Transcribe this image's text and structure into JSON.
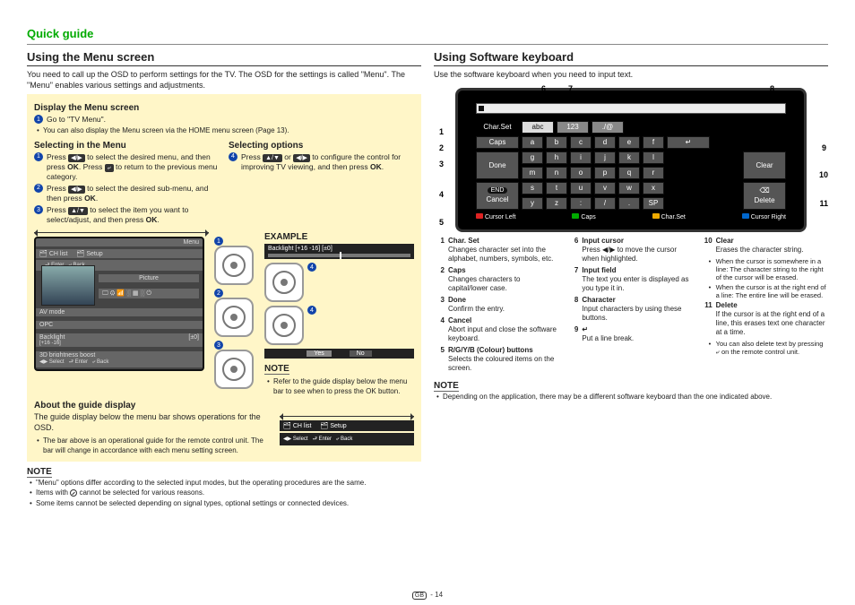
{
  "page_label": "14",
  "region_code": "GB",
  "quick_guide": "Quick guide",
  "left": {
    "heading": "Using the Menu screen",
    "intro": "You need to call up the OSD to perform settings for the TV. The OSD for the settings is called \"Menu\". The \"Menu\" enables various settings and adjustments.",
    "display_heading": "Display the Menu screen",
    "display_step1": "Go to \"TV Menu\".",
    "display_note": "You can also display the Menu screen via the HOME menu screen (Page 13).",
    "selecting_heading": "Selecting in the Menu",
    "sel_options_heading": "Selecting options",
    "example_label": "EXAMPLE",
    "sel_step1a": "Press ",
    "sel_step1b": " to select the desired menu, and then press ",
    "sel_step1c": ". Press ",
    "sel_step1d": " to return to the previous menu category.",
    "ok": "OK",
    "sel_step2a": "Press ",
    "sel_step2b": " to select the desired sub-menu, and then press ",
    "sel_step2c": ".",
    "sel_step3a": "Press ",
    "sel_step3b": " to select the item you want to select/adjust, and then press ",
    "sel_step3c": ".",
    "sel_opt4a": "Press ",
    "sel_opt4b": " or ",
    "sel_opt4c": " to configure the control for improving TV viewing, and then press ",
    "sel_opt4d": ".",
    "mid_note": "Refer to the guide display below the menu bar to see when to press the OK button.",
    "tv_labels": {
      "menu": "Menu",
      "chlist": "CH list",
      "setup": "Setup",
      "enter": "Enter",
      "back": "Back",
      "picture": "Picture",
      "avmode": "AV mode",
      "opc": "OPC",
      "backlight": "Backlight",
      "select": "Select",
      "threed": "3D brightness boost",
      "yes": "Yes",
      "no": "No"
    },
    "backlight_range": "[+16   -16]",
    "backlight_value": "[±0]",
    "about_heading": "About the guide display",
    "about_text": "The guide display below the menu bar shows operations for the OSD.",
    "about_bullet": "The bar above is an operational guide for the remote control unit. The bar will change in accordance with each menu setting screen.",
    "note_label": "NOTE",
    "note_items": [
      "\"Menu\" options differ according to the selected input modes, but the operating procedures are the same.",
      "Items with  cannot be selected for various reasons.",
      "Some items cannot be selected depending on signal types, optional settings or connected devices."
    ]
  },
  "right": {
    "heading": "Using Software keyboard",
    "intro": "Use the software keyboard when you need to input text.",
    "kb": {
      "charset": "Char.Set",
      "abc": "abc",
      "num": "123",
      "sym": "./@",
      "caps": "Caps",
      "done": "Done",
      "cancel": "Cancel",
      "clear": "Clear",
      "delete": "Delete",
      "end": "END",
      "sp": "SP",
      "cursor_left": "Cursor Left",
      "cursor_right": "Cursor Right",
      "row1": [
        "a",
        "b",
        "c",
        "d",
        "e",
        "f"
      ],
      "row2": [
        "g",
        "h",
        "i",
        "j",
        "k",
        "l"
      ],
      "row3": [
        "m",
        "n",
        "o",
        "p",
        "q",
        "r"
      ],
      "row4": [
        "s",
        "t",
        "u",
        "v",
        "w",
        "x"
      ],
      "row5": [
        "y",
        "z",
        ":",
        "/",
        "."
      ],
      "enter_sym": "↵",
      "del_sym": "⌫",
      "hints": {
        "caps": "Caps",
        "charset": "Char.Set"
      }
    },
    "callouts": [
      "1",
      "2",
      "3",
      "4",
      "5",
      "6",
      "7",
      "8",
      "9",
      "10",
      "11"
    ],
    "defs": {
      "c1": [
        {
          "n": "1",
          "t": "Char. Set",
          "d": "Changes character set into the alphabet, numbers, symbols, etc."
        },
        {
          "n": "2",
          "t": "Caps",
          "d": "Changes characters to capital/lower case."
        },
        {
          "n": "3",
          "t": "Done",
          "d": "Confirm the entry."
        },
        {
          "n": "4",
          "t": "Cancel",
          "d": "Abort input and close the software keyboard."
        },
        {
          "n": "5",
          "t": "R/G/Y/B (Colour) buttons",
          "d": "Selects the coloured items on the screen."
        }
      ],
      "c2": [
        {
          "n": "6",
          "t": "Input cursor",
          "d": "Press ◀/▶ to move the cursor when highlighted."
        },
        {
          "n": "7",
          "t": "Input field",
          "d": "The text you enter is displayed as you type it in."
        },
        {
          "n": "8",
          "t": "Character",
          "d": "Input characters by using these buttons."
        },
        {
          "n": "9",
          "t": "↵",
          "d": "Put a line break."
        }
      ],
      "c3": [
        {
          "n": "10",
          "t": "Clear",
          "d": "Erases the character string.",
          "subs": [
            "When the cursor is somewhere in a line: The character string to the right of the cursor will be erased.",
            "When the cursor is at the right end of a line: The entire line will be erased."
          ]
        },
        {
          "n": "11",
          "t": "Delete",
          "d": "If the cursor is at the right end of a line, this erases text one character at a time.",
          "subs": [
            "You can also delete text by pressing ⤶ on the remote control unit."
          ]
        }
      ]
    },
    "note_label": "NOTE",
    "note_item": "Depending on the application, there may be a different software keyboard than the one indicated above."
  }
}
